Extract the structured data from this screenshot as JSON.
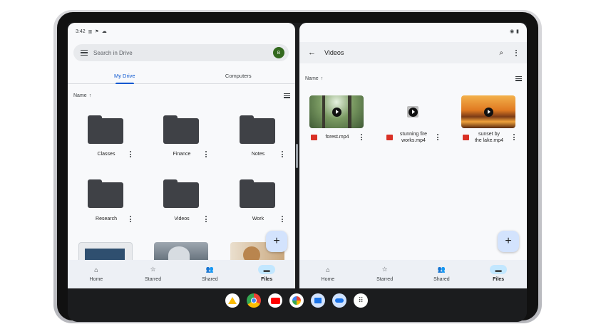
{
  "left_pane": {
    "status_time": "3:42",
    "status_icons": [
      "bars-icon",
      "signal-icon",
      "cloud-icon"
    ],
    "search_placeholder": "Search in Drive",
    "avatar_letter": "B",
    "tabs": [
      {
        "label": "My Drive",
        "active": true
      },
      {
        "label": "Computers",
        "active": false
      }
    ],
    "sort_label": "Name",
    "folders": [
      {
        "name": "Classes"
      },
      {
        "name": "Finance"
      },
      {
        "name": "Notes"
      },
      {
        "name": "Research"
      },
      {
        "name": "Videos"
      },
      {
        "name": "Work"
      }
    ],
    "fab_label": "+",
    "nav": [
      {
        "label": "Home",
        "icon": "home-icon",
        "active": false
      },
      {
        "label": "Starred",
        "icon": "star-icon",
        "active": false
      },
      {
        "label": "Shared",
        "icon": "people-icon",
        "active": false
      },
      {
        "label": "Files",
        "icon": "folder-icon",
        "active": true
      }
    ]
  },
  "right_pane": {
    "title": "Videos",
    "sort_label": "Name",
    "videos": [
      {
        "name": "forest.mp4"
      },
      {
        "name_line1": "stunning fire",
        "name_line2": "works.mp4"
      },
      {
        "name_line1": "sunset by",
        "name_line2": "the lake.mp4"
      }
    ],
    "fab_label": "+",
    "nav": [
      {
        "label": "Home",
        "icon": "home-icon",
        "active": false
      },
      {
        "label": "Starred",
        "icon": "star-icon",
        "active": false
      },
      {
        "label": "Shared",
        "icon": "people-icon",
        "active": false
      },
      {
        "label": "Files",
        "icon": "folder-icon",
        "active": true
      }
    ]
  },
  "dock": {
    "apps": [
      "drive-icon",
      "chrome-icon",
      "youtube-icon",
      "photos-icon",
      "files-icon",
      "meet-icon",
      "app-launcher-icon"
    ]
  },
  "colors": {
    "accent": "#0b57d0",
    "nav_active": "#c2e7ff",
    "fab": "#d3e3fd",
    "folder": "#3f4146",
    "video_badge": "#d93025"
  }
}
